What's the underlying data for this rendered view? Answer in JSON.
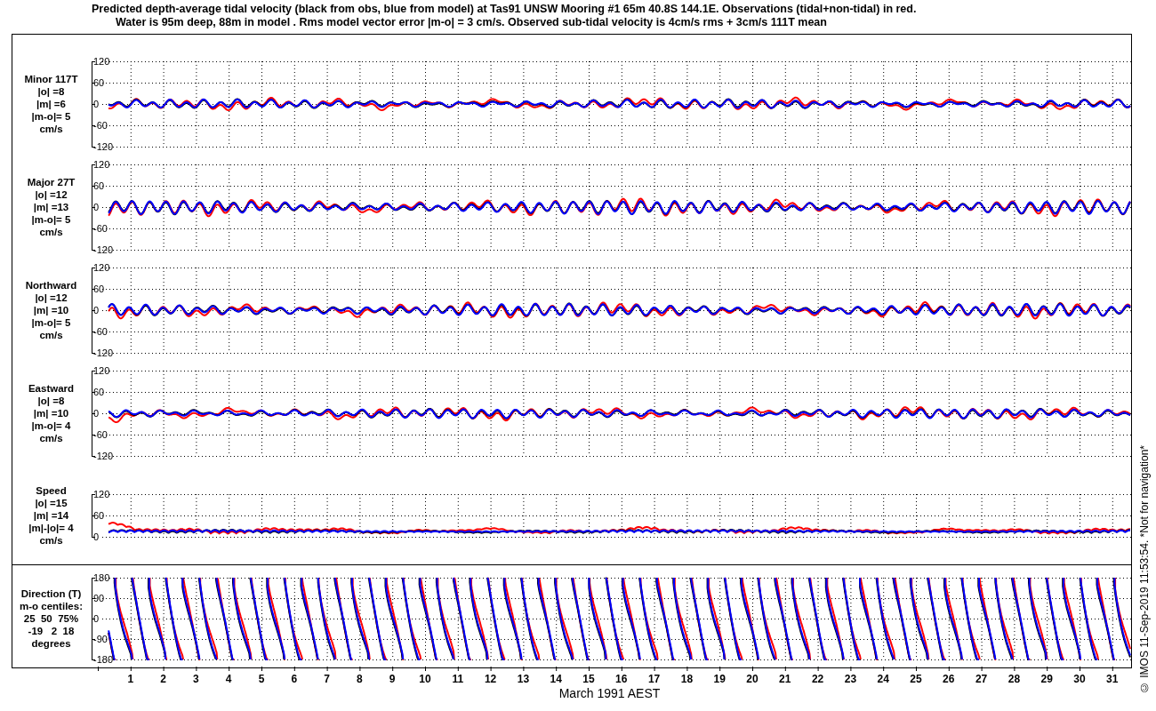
{
  "title": {
    "lines": [
      "Predicted depth-average tidal velocity (black from obs, blue from model) at Tas91 UNSW Mooring #1 65m 40.8S 144.1E. Observations (tidal+non-tidal) in red.",
      "Water is 95m deep, 88m in model . Rms model vector error |m-o| = 3 cm/s. Observed sub-tidal velocity is 4cm/s rms + 3cm/s 111T mean"
    ]
  },
  "panels": [
    {
      "kind": "velocity",
      "label_lines": [
        "Minor 117T",
        "|o| =8",
        "|m| =6",
        "|m-o|= 5",
        "cm/s"
      ],
      "yticks": [
        "120",
        "60",
        "0",
        "-60",
        "-120"
      ]
    },
    {
      "kind": "velocity",
      "label_lines": [
        "Major 27T",
        "|o| =12",
        "|m| =13",
        "|m-o|= 5",
        "cm/s"
      ],
      "yticks": [
        "120",
        "60",
        "0",
        "-60",
        "-120"
      ]
    },
    {
      "kind": "velocity",
      "label_lines": [
        "Northward",
        "|o| =12",
        "|m| =10",
        "|m-o|= 5",
        "cm/s"
      ],
      "yticks": [
        "120",
        "60",
        "0",
        "-60",
        "-120"
      ]
    },
    {
      "kind": "velocity",
      "label_lines": [
        "Eastward",
        "|o| =8",
        "|m| =10",
        "|m-o|= 4",
        "cm/s"
      ],
      "yticks": [
        "120",
        "60",
        "0",
        "-60",
        "-120"
      ]
    },
    {
      "kind": "speed",
      "label_lines": [
        "Speed",
        "|o| =15",
        "|m| =14",
        "|m|-|o|= 4",
        "cm/s"
      ],
      "yticks": [
        "120",
        "60",
        "0"
      ]
    }
  ],
  "direction_panel": {
    "kind": "direction",
    "label_lines": [
      "Direction (T)",
      "m-o centiles:",
      "25  50  75%",
      "-19   2  18",
      "degrees"
    ],
    "yticks": [
      "180",
      "90",
      "0",
      "-90",
      "-180"
    ]
  },
  "x_axis": {
    "ticks": [
      "1",
      "2",
      "3",
      "4",
      "5",
      "6",
      "7",
      "8",
      "9",
      "10",
      "11",
      "12",
      "13",
      "14",
      "15",
      "16",
      "17",
      "18",
      "19",
      "20",
      "21",
      "22",
      "23",
      "24",
      "25",
      "26",
      "27",
      "28",
      "29",
      "30",
      "31"
    ],
    "label": "March 1991 AEST"
  },
  "credit": "© IMOS 11-Sep-2019 11:53:54.  *Not for navigation*"
}
